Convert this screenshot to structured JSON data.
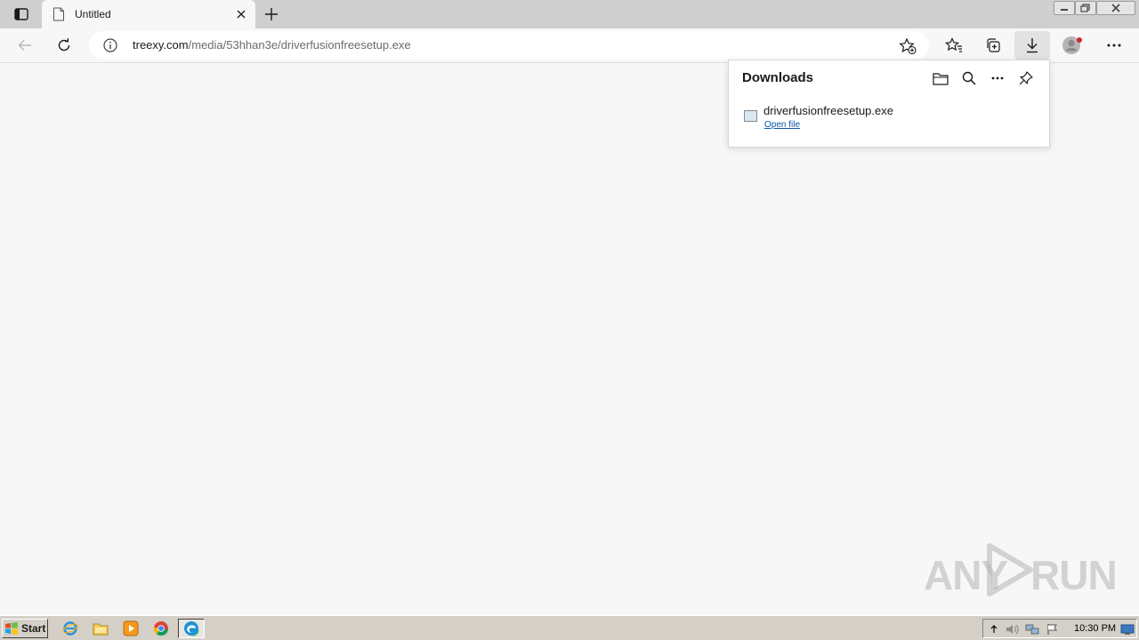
{
  "browser": {
    "tab": {
      "title": "Untitled"
    },
    "address": {
      "host": "treexy.com",
      "path": "/media/53hhan3e/driverfusionfreesetup.exe"
    }
  },
  "downloads": {
    "title": "Downloads",
    "items": [
      {
        "filename": "driverfusionfreesetup.exe",
        "action_label": "Open file"
      }
    ]
  },
  "watermark": {
    "left": "ANY",
    "right": "RUN"
  },
  "taskbar": {
    "start_label": "Start",
    "clock": "10:30 PM"
  },
  "colors": {
    "accent": "#0b57a8",
    "profile_badge": "#d12b2b"
  }
}
